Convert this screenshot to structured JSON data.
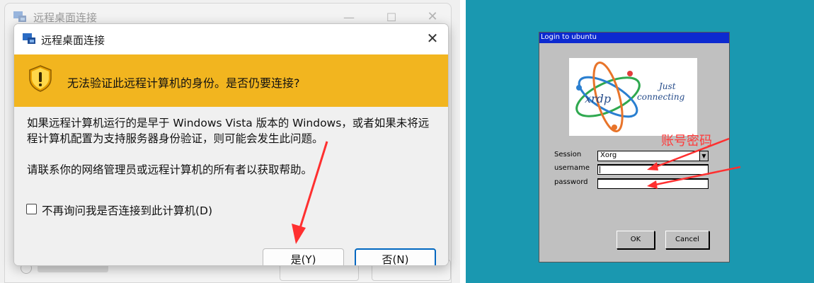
{
  "rdp": {
    "bg_window_title": "远程桌面连接",
    "dialog_title": "远程桌面连接",
    "warning": "无法验证此远程计算机的身份。是否仍要连接?",
    "body_line1": "如果远程计算机运行的是早于 Windows Vista 版本的 Windows，或者如果未将远程计算机配置为支持服务器身份验证，则可能会发生此问题。",
    "body_line2": "请联系你的网络管理员或远程计算机的所有者以获取帮助。",
    "dont_ask_label": "不再询问我是否连接到此计算机(D)",
    "dont_ask_checked": false,
    "yes_label": "是(Y)",
    "no_label": "否(N)",
    "warning_color": "#f2b51f",
    "accent_color": "#0067c0",
    "icons": [
      "remote-desktop-icon",
      "shield-warning-icon",
      "close-icon",
      "minimize-icon",
      "maximize-icon"
    ]
  },
  "xrdp": {
    "window_title": "Login to ubuntu",
    "logo_just": "Just",
    "logo_connecting": "connecting",
    "logo_xrdp": "xrdp",
    "session_label": "Session",
    "session_value": "Xorg",
    "username_label": "username",
    "password_label": "password",
    "username_value": "",
    "password_value": "",
    "ok_label": "OK",
    "cancel_label": "Cancel",
    "background_color": "#1a98b0",
    "titlebar_color": "#0c2ad0"
  },
  "annotation": {
    "text": "账号密码",
    "color": "#ff3a3a"
  }
}
